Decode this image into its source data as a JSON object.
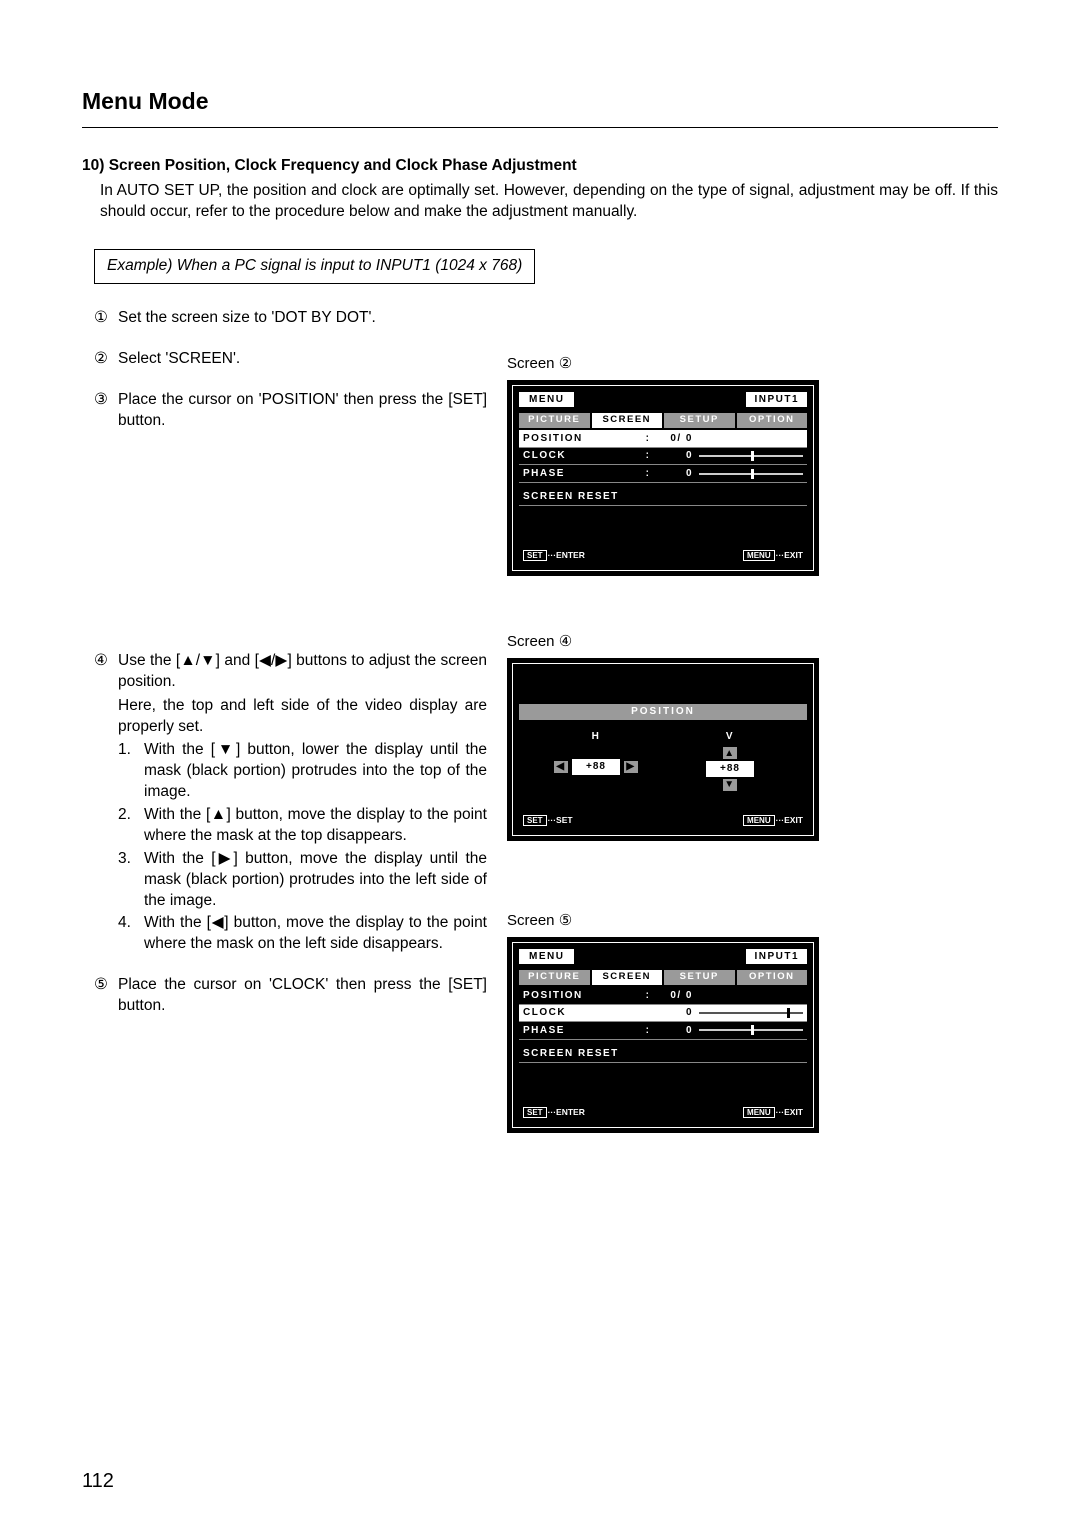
{
  "title": "Menu Mode",
  "section_title": "10) Screen Position, Clock Frequency and Clock Phase Adjustment",
  "intro": "In AUTO SET UP, the position and clock are optimally set. However, depending on the type of signal, adjustment may be off. If this should occur, refer to the procedure below and make  the adjustment manually.",
  "example": "Example) When a PC signal is input to INPUT1 (1024 x 768)",
  "steps": {
    "s1": {
      "n": "①",
      "text": "Set the screen size to 'DOT BY DOT'."
    },
    "s2": {
      "n": "②",
      "text": "Select 'SCREEN'."
    },
    "s3": {
      "n": "③",
      "text": "Place the cursor on 'POSITION' then press the [SET] button."
    },
    "s4": {
      "n": "④",
      "para1": "Use the [▲/▼] and [◀/▶] buttons to adjust the screen position.",
      "para2": "Here, the top and left side of the video display are properly set.",
      "sub1": {
        "n": "1.",
        "t": "With the [▼] button, lower the display until the mask (black portion) protrudes into the top of the image."
      },
      "sub2": {
        "n": "2.",
        "t": "With the [▲] button, move the display to the point where the mask at the top disappears."
      },
      "sub3": {
        "n": "3.",
        "t": "With the [▶] button, move the display until the mask (black portion) protrudes into the left side of the image."
      },
      "sub4": {
        "n": "4.",
        "t": "With the [◀] button, move the display to the point where the mask on the left side disappears."
      }
    },
    "s5": {
      "n": "⑤",
      "text": "Place the cursor on 'CLOCK' then press the [SET] button."
    }
  },
  "screen_labels": {
    "s2": "Screen ②",
    "s4": "Screen ④",
    "s5": "Screen ⑤"
  },
  "osd": {
    "menu": "MENU",
    "input": "INPUT1",
    "tabs": {
      "picture": "PICTURE",
      "screen": "SCREEN",
      "setup": "SETUP",
      "option": "OPTION"
    },
    "rows": {
      "position": "POSITION",
      "clock": "CLOCK",
      "phase": "PHASE",
      "reset": "SCREEN RESET"
    },
    "position_val": "0/ 0",
    "clock_val": "0",
    "phase_val": "0",
    "btn_set": "SET",
    "btn_menu": "MENU",
    "enter": "···ENTER",
    "set_lbl": "···SET",
    "exit": "···EXIT"
  },
  "position_screen": {
    "title": "POSITION",
    "h": "H",
    "v": "V",
    "hval": "+88",
    "vval": "+88"
  },
  "page_number": "112"
}
